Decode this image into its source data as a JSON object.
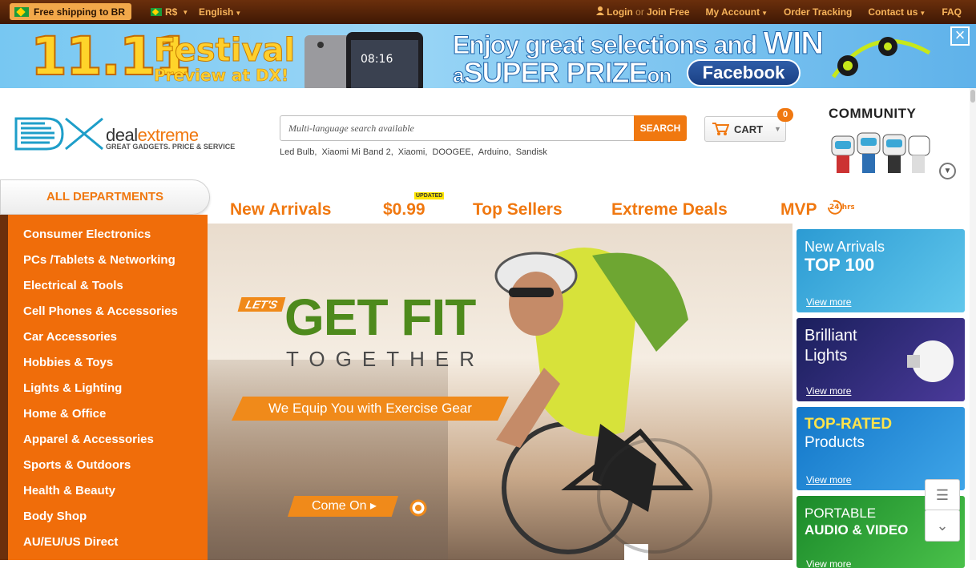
{
  "topbar": {
    "free_shipping": "Free shipping to BR",
    "currency": "R$",
    "language": "English",
    "login": "Login",
    "or": "or",
    "join": "Join Free",
    "my_account": "My Account",
    "order_tracking": "Order Tracking",
    "contact_us": "Contact us",
    "faq": "FAQ"
  },
  "banner": {
    "number": "11.11",
    "festival": "Festival",
    "preview": "Preview at DX!",
    "phone_time": "08:16",
    "line1": "Enjoy great selections and",
    "win": "WIN",
    "line2_a": "a",
    "line2_b": "SUPER PRIZE",
    "line2_c": "on",
    "facebook": "Facebook"
  },
  "logo": {
    "deal": "deal",
    "extreme": "extreme",
    "tagline": "GREAT GADGETS. PRICE & SERVICE"
  },
  "search": {
    "placeholder": "Multi-language search available",
    "button": "SEARCH",
    "hot_keywords": [
      "Led Bulb,",
      "Xiaomi Mi Band 2,",
      "Xiaomi,",
      "DOOGEE,",
      "Arduino,",
      "Sandisk"
    ]
  },
  "cart": {
    "label": "CART",
    "count": "0"
  },
  "community": {
    "title": "COMMUNITY"
  },
  "departments": {
    "title": "ALL DEPARTMENTS",
    "items": [
      "Consumer Electronics",
      "PCs /Tablets & Networking",
      "Electrical & Tools",
      "Cell Phones & Accessories",
      "Car Accessories",
      "Hobbies & Toys",
      "Lights & Lighting",
      "Home & Office",
      "Apparel & Accessories",
      "Sports & Outdoors",
      "Health & Beauty",
      "Body Shop",
      "AU/EU/US Direct"
    ]
  },
  "nav": {
    "new_arrivals": "New Arrivals",
    "price": "$0.99",
    "updated": "UPDATED",
    "top_sellers": "Top Sellers",
    "extreme_deals": "Extreme Deals",
    "mvp": "MVP",
    "hrs": "24 hrs"
  },
  "hero": {
    "lets": "LET'S",
    "get_fit": "GET FIT",
    "together": "TOGETHER",
    "equip": "We Equip You with Exercise Gear",
    "come_on": "Come On"
  },
  "promos": [
    {
      "line1": "New Arrivals",
      "line2": "TOP 100",
      "more": "View more"
    },
    {
      "line1": "Brilliant",
      "line2": "Lights",
      "more": "View more"
    },
    {
      "line1": "TOP-RATED",
      "line2": "Products",
      "more": "View more"
    },
    {
      "line1": "PORTABLE",
      "line2": "AUDIO & VIDEO",
      "more": "View more"
    }
  ],
  "colors": {
    "accent": "#f07810",
    "topbar": "#4a1f06",
    "dept_bg": "#f06d0a",
    "hero_green": "#4e8a1c"
  },
  "icons": [
    "flag-brazil-icon",
    "user-icon",
    "cart-icon",
    "close-icon",
    "chevron-down-icon",
    "feedback-icon",
    "scroll-down-icon"
  ]
}
